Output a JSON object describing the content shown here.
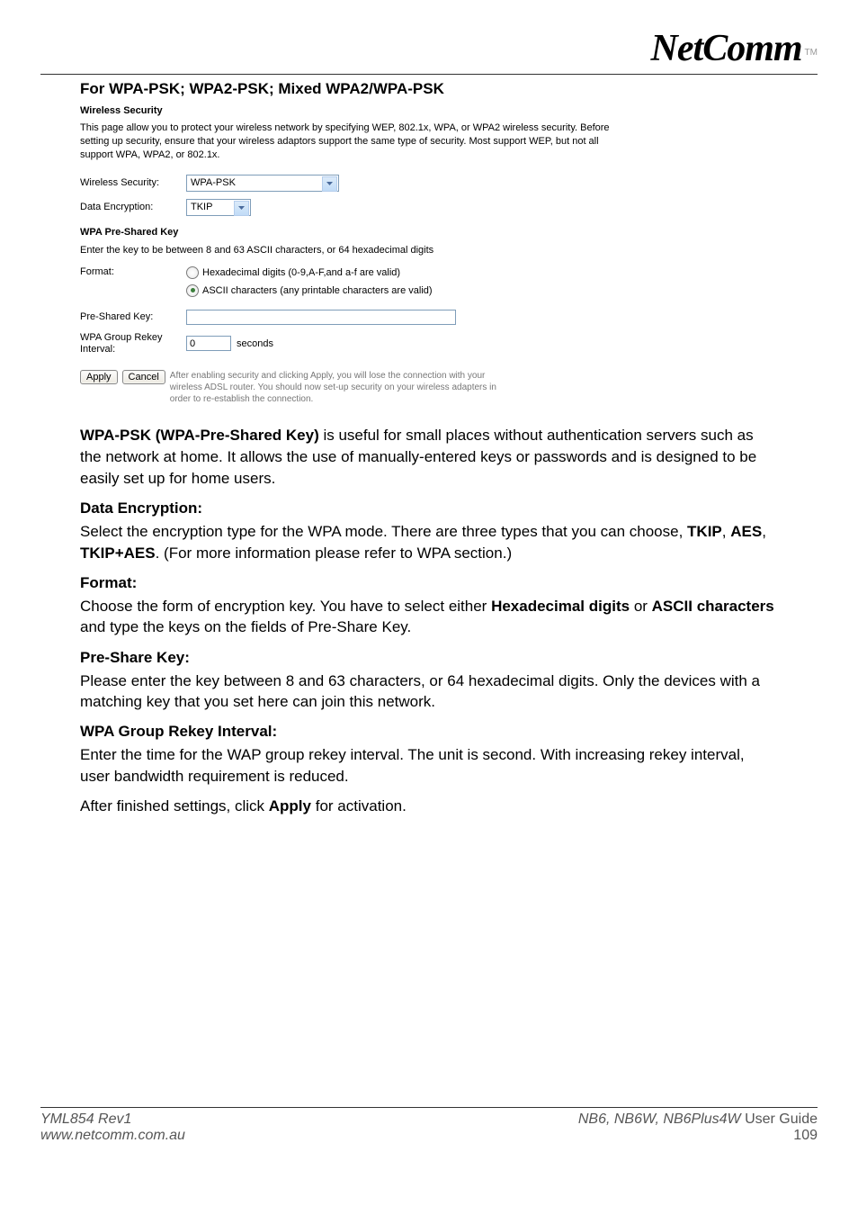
{
  "logo": {
    "text": "NetComm",
    "tm": "TM"
  },
  "section_title": "For WPA-PSK; WPA2-PSK; Mixed WPA2/WPA-PSK",
  "screenshot": {
    "title": "Wireless Security",
    "description": "This page allow you to protect your wireless network by specifying WEP, 802.1x, WPA, or WPA2 wireless security. Before setting up security, ensure that your wireless adaptors support the same type of security. Most support WEP, but not all support WPA, WPA2, or 802.1x.",
    "security_label": "Wireless Security:",
    "security_value": "WPA-PSK",
    "encryption_label": "Data Encryption:",
    "encryption_value": "TKIP",
    "psk_heading": "WPA Pre-Shared Key",
    "psk_note": "Enter the key to be between 8 and 63 ASCII characters, or 64 hexadecimal digits",
    "format_label": "Format:",
    "format_option1": "Hexadecimal digits (0-9,A-F,and a-f are valid)",
    "format_option2": "ASCII characters (any printable characters are valid)",
    "preshared_label": "Pre-Shared Key:",
    "preshared_value": "",
    "rekey_label": "WPA Group Rekey Interval:",
    "rekey_value": "0",
    "rekey_unit": "seconds",
    "apply_btn": "Apply",
    "cancel_btn": "Cancel",
    "btn_note": "After enabling security and clicking Apply, you will lose the connection with your wireless ADSL router. You should now set-up security on your wireless adapters in order to re-establish the connection."
  },
  "body": {
    "intro_bold": "WPA-PSK (WPA-Pre-Shared Key)",
    "intro_rest": " is useful for small places without authentication servers such as the network at home. It allows the use of manually-entered keys or passwords and is designed to be easily set up for home users.",
    "data_enc_head": "Data Encryption:",
    "data_enc_p1": "Select the encryption type for the WPA mode. There are three types that you can choose, ",
    "data_enc_b1": "TKIP",
    "data_enc_s1": ", ",
    "data_enc_b2": "AES",
    "data_enc_s2": ", ",
    "data_enc_b3": "TKIP+AES",
    "data_enc_p2": ". (For more information please refer to WPA section.)",
    "format_head": "Format:",
    "format_p1": "Choose the form of encryption key. You have to select either ",
    "format_b1": "Hexadecimal digits",
    "format_s1": " or ",
    "format_b2": "ASCII characters",
    "format_p2": " and type the keys on the fields of Pre-Share Key.",
    "preshare_head": "Pre-Share Key:",
    "preshare_body": "Please enter the key between 8 and 63 characters, or 64 hexadecimal digits. Only the devices with a matching key that you set here can join this network.",
    "rekey_head": "WPA Group Rekey Interval:",
    "rekey_body": "Enter the time for the WAP group rekey interval. The unit is second. With increasing rekey interval, user bandwidth requirement is reduced.",
    "after_p1": "After finished settings, click ",
    "after_b1": "Apply",
    "after_p2": " for activation."
  },
  "footer": {
    "left_line1": "YML854 Rev1",
    "left_line2": "www.netcomm.com.au",
    "right_italic": "NB6, NB6W, NB6Plus4W ",
    "right_normal": "User Guide",
    "page": "109"
  }
}
